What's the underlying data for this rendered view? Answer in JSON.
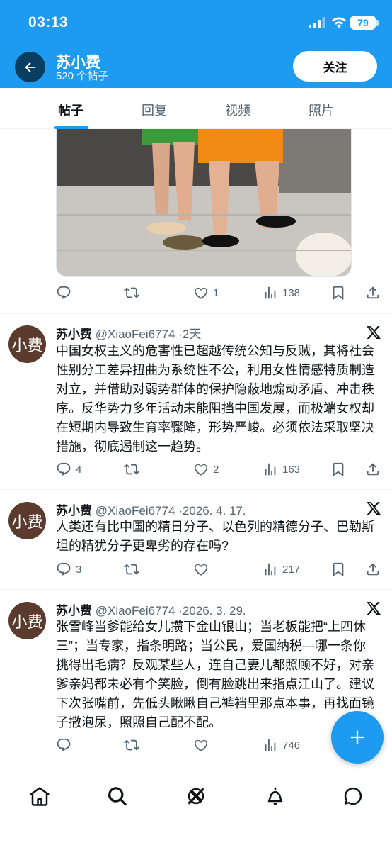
{
  "status_bar": {
    "time": "03:13",
    "battery": "79"
  },
  "header": {
    "name": "苏小费",
    "post_count": "520 个帖子",
    "follow_label": "关注"
  },
  "tabs": [
    {
      "label": "帖子",
      "active": true
    },
    {
      "label": "回复",
      "active": false
    },
    {
      "label": "视频",
      "active": false
    },
    {
      "label": "照片",
      "active": false
    }
  ],
  "top_post": {
    "likes": "1",
    "views": "138"
  },
  "posts": [
    {
      "avatar_text": "小费",
      "name": "苏小费",
      "handle": "@XiaoFei6774",
      "time": "2天",
      "text": "中国女权主义的危害性已超越传统公知与反贼，其将社会性别分工差异扭曲为系统性不公，利用女性情感特质制造对立，并借助对弱势群体的保护隐蔽地煽动矛盾、冲击秩序。反华势力多年活动未能阻挡中国发展，而极端女权却在短期内导致生育率骤降，形势严峻。必须依法采取坚决措施，彻底遏制这一趋势。",
      "replies": "4",
      "likes": "2",
      "views": "163"
    },
    {
      "avatar_text": "小费",
      "name": "苏小费",
      "handle": "@XiaoFei6774",
      "time": "2026. 4. 17.",
      "text": "人类还有比中国的精日分子、以色列的精德分子、巴勒斯坦的精犹分子更卑劣的存在吗?",
      "replies": "3",
      "likes": "",
      "views": "217"
    },
    {
      "avatar_text": "小费",
      "name": "苏小费",
      "handle": "@XiaoFei6774",
      "time": "2026. 3. 29.",
      "text": "张雪峰当爹能给女儿攒下金山银山；当老板能把“上四休三”；当专家，指条明路；当公民，爱国纳税—哪一条你挑得出毛病？反观某些人，连自己妻儿都照顾不好，对亲爹亲妈都未必有个笑脸，倒有脸跳出来指点江山了。建议下次张嘴前，先低头瞅瞅自己裤裆里那点本事，再找面镜子撒泡尿，照照自己配不配。",
      "replies": "",
      "likes": "",
      "views": "746"
    }
  ],
  "colors": {
    "accent": "#1d9bf0",
    "text": "#0f1419",
    "muted": "#536471",
    "avatar": "#5a3b2e"
  },
  "icons": [
    "back-arrow-icon",
    "reply-icon",
    "repost-icon",
    "like-icon",
    "views-icon",
    "bookmark-icon",
    "share-icon",
    "x-logo-icon",
    "compose-plus-icon",
    "home-icon",
    "search-icon",
    "grok-icon",
    "notifications-icon",
    "messages-icon"
  ]
}
